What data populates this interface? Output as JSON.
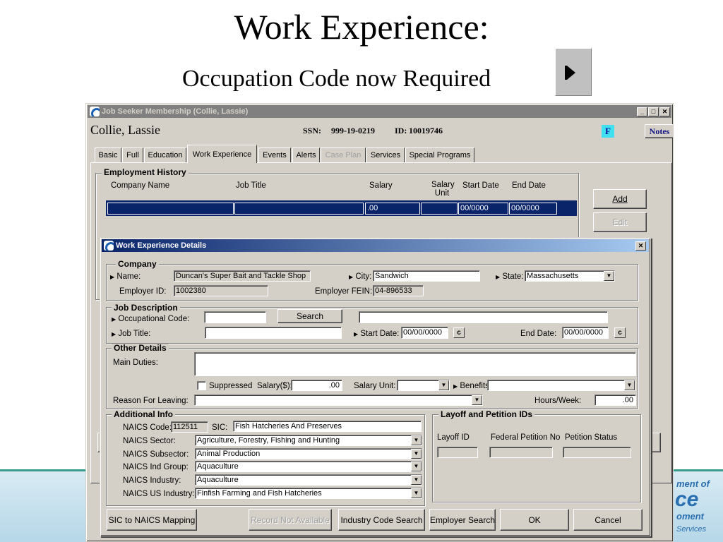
{
  "slide": {
    "title": "Work Experience:",
    "subtitle": "Occupation Code now Required"
  },
  "footer": {
    "brand_line1": "ment of",
    "brand_line2": "ce",
    "brand_line3": "oment",
    "brand_line4": "Services"
  },
  "main_window": {
    "title": "Job Seeker Membership (Collie, Lassie)",
    "name": "Collie, Lassie",
    "ssn_label": "SSN:",
    "ssn_value": "999-19-0219",
    "id_label": "ID:",
    "id_value": "10019746",
    "f_badge": "F",
    "notes_button": "Notes",
    "controls": {
      "minimize": "_",
      "maximize": "□",
      "close": "✕"
    }
  },
  "tabs": [
    {
      "label": "Basic"
    },
    {
      "label": "Full"
    },
    {
      "label": "Education"
    },
    {
      "label": "Work Experience"
    },
    {
      "label": "Events"
    },
    {
      "label": "Alerts"
    },
    {
      "label": "Case Plan"
    },
    {
      "label": "Services"
    },
    {
      "label": "Special Programs"
    }
  ],
  "employment_history": {
    "title": "Employment History",
    "columns": [
      "Company Name",
      "Job Title",
      "Salary",
      "Salary Unit",
      "Start Date",
      "End Date"
    ],
    "row": {
      "company": "",
      "job_title": "",
      "salary": ".00",
      "salary_unit": "",
      "start_date": "00/0000",
      "end_date": "00/0000"
    },
    "add_button": "Add",
    "edit_button": "Edit"
  },
  "dialog": {
    "title": "Work Experience Details",
    "close": "✕",
    "company": {
      "title": "Company",
      "name_label": "Name:",
      "name_value": "Duncan's Super Bait and Tackle Shop",
      "city_label": "City:",
      "city_value": "Sandwich",
      "state_label": "State:",
      "state_value": "Massachusetts",
      "employer_id_label": "Employer ID:",
      "employer_id_value": "1002380",
      "fein_label": "Employer FEIN:",
      "fein_value": "04-896533"
    },
    "job_description": {
      "title": "Job Description",
      "occ_code_label": "Occupational Code:",
      "occ_code_value": "",
      "search_button": "Search",
      "occ_desc_value": "",
      "job_title_label": "Job Title:",
      "job_title_value": "",
      "start_date_label": "Start Date:",
      "start_date_value": "00/00/0000",
      "end_date_label": "End Date:",
      "end_date_value": "00/00/0000",
      "cal_icon": "c"
    },
    "other_details": {
      "title": "Other Details",
      "main_duties_label": "Main Duties:",
      "main_duties_value": "",
      "suppressed_label": "Suppressed",
      "salary_label": "Salary($):",
      "salary_value": ".00",
      "salary_unit_label": "Salary Unit:",
      "salary_unit_value": "",
      "benefits_label": "Benefits:",
      "benefits_value": "",
      "reason_label": "Reason For Leaving:",
      "reason_value": "",
      "hours_label": "Hours/Week:",
      "hours_value": ".00"
    },
    "additional_info": {
      "title": "Additional Info",
      "naics_code_label": "NAICS Code:",
      "naics_code_value": "112511",
      "sic_label": "SIC:",
      "sic_value": "Fish Hatcheries And Preserves",
      "sector_label": "NAICS Sector:",
      "sector_value": "Agriculture, Forestry, Fishing and Hunting",
      "subsector_label": "NAICS Subsector:",
      "subsector_value": "Animal Production",
      "ind_group_label": "NAICS Ind Group:",
      "ind_group_value": "Aquaculture",
      "industry_label": "NAICS Industry:",
      "industry_value": "Aquaculture",
      "us_industry_label": "NAICS US Industry:",
      "us_industry_value": "Finfish Farming and Fish Hatcheries"
    },
    "layoff": {
      "title": "Layoff and Petition IDs",
      "layoff_id_label": "Layoff ID",
      "federal_petition_label": "Federal Petition No",
      "petition_status_label": "Petition Status"
    },
    "buttons": {
      "sic_to_naics": "SIC to NAICS Mapping",
      "record_not_available": "Record Not Available",
      "industry_code_search": "Industry Code Search",
      "employer_search": "Employer Search",
      "ok": "OK",
      "cancel": "Cancel"
    }
  }
}
